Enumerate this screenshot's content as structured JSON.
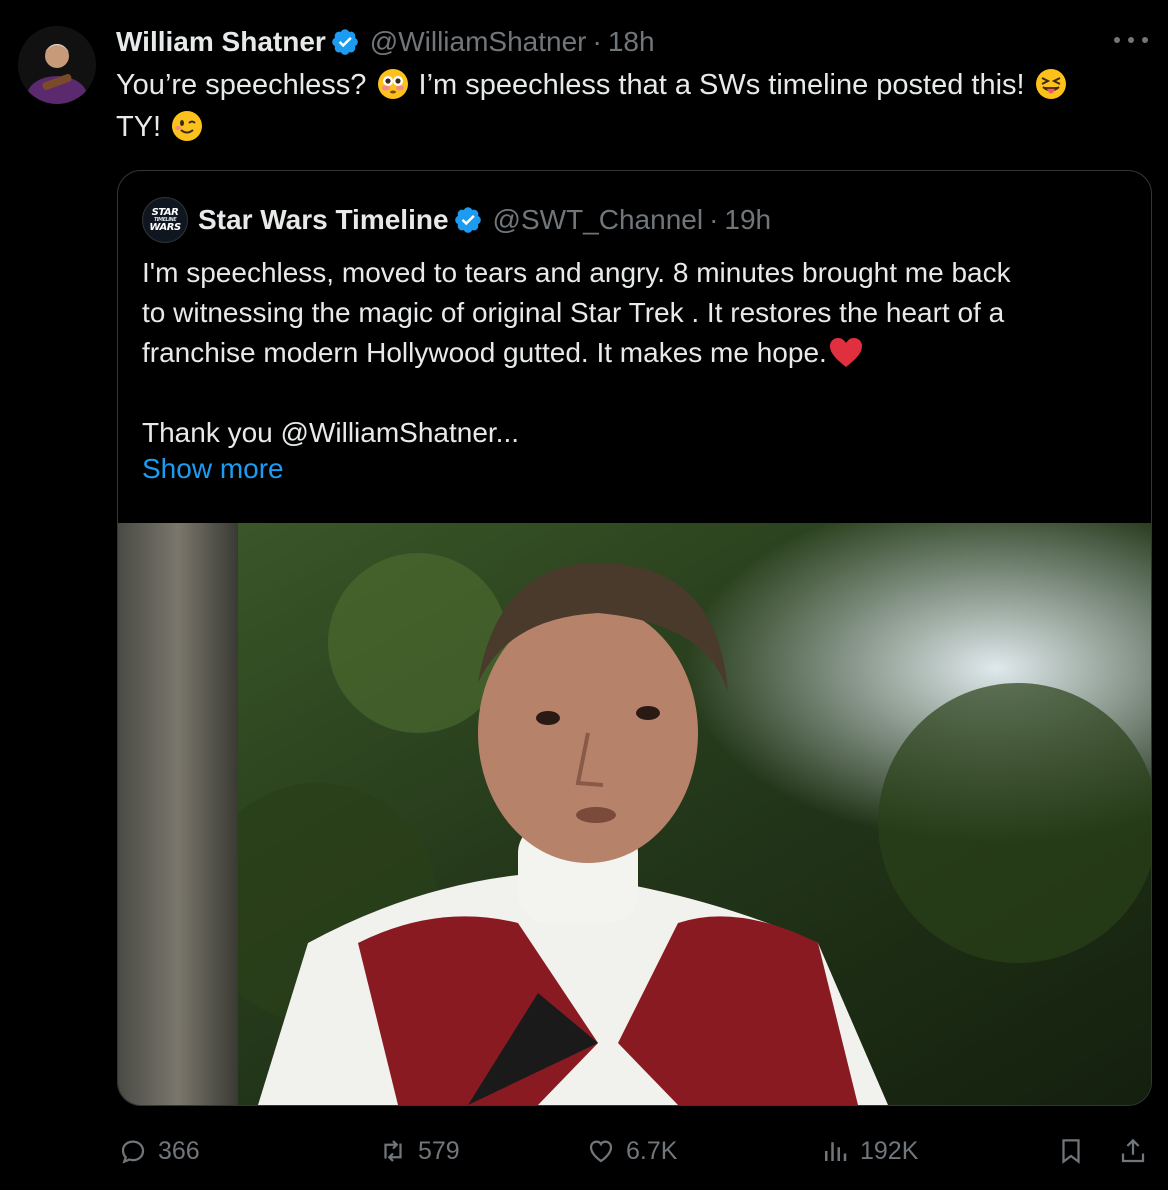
{
  "tweet": {
    "author_name": "William Shatner",
    "handle": "@WilliamShatner",
    "separator": "·",
    "time": "18h",
    "text_part1": "You’re speechless? ",
    "text_part2": " I’m speechless that a SWs timeline posted this! ",
    "text_part3": "TY! ",
    "emojis": [
      "flushed-face",
      "squinting-tongue-face",
      "winking-face"
    ]
  },
  "quote": {
    "author_name": "Star Wars Timeline",
    "handle": "@SWT_Channel",
    "separator": "·",
    "time": "19h",
    "avatar_text_top": "STAR",
    "avatar_text_mid": "TIMELINE",
    "avatar_text_bottom": "WARS",
    "line1": "I'm speechless, moved to tears and angry. 8 minutes brought me back",
    "line2": "to witnessing the magic of original Star Trek . It restores the heart of a",
    "line3": "franchise modern Hollywood gutted. It makes me hope.",
    "line4": "Thank you @WilliamShatner...",
    "show_more": "Show more",
    "media_description_icon": "video-thumbnail"
  },
  "actions": {
    "replies": "366",
    "reposts": "579",
    "likes": "6.7K",
    "views": "192K"
  },
  "colors": {
    "background": "#000000",
    "text": "#e7e9ea",
    "secondary": "#71767b",
    "link": "#1d9bf0",
    "verified": "#1d9bf0",
    "border": "#333639"
  }
}
